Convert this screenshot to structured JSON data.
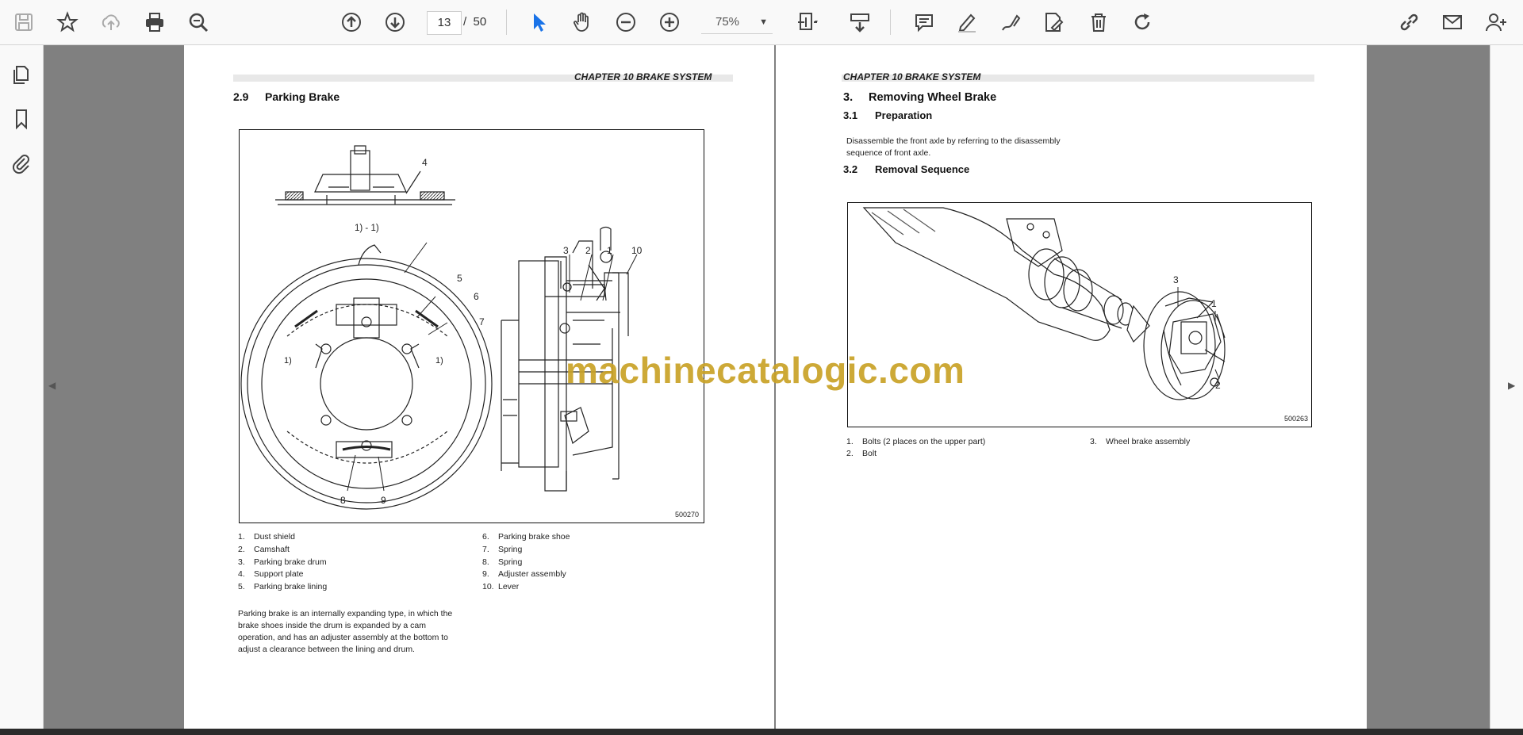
{
  "toolbar": {
    "current_page": "13",
    "page_separator": "/",
    "total_pages": "50",
    "zoom": "75%"
  },
  "left_page": {
    "header": "CHAPTER 10  BRAKE SYSTEM",
    "section_num": "2.9",
    "section_title": "Parking Brake",
    "figure_id": "500270",
    "callouts": {
      "top_caption": "1) - 1)",
      "c4": "4",
      "c5": "5",
      "c6": "6",
      "c7": "7",
      "c8": "8",
      "c9": "9",
      "cl1": "1)",
      "cr1": "1)",
      "s3": "3",
      "s2": "2",
      "s1": "1",
      "s10": "10"
    },
    "legend_left": [
      {
        "n": "1.",
        "t": "Dust shield"
      },
      {
        "n": "2.",
        "t": "Camshaft"
      },
      {
        "n": "3.",
        "t": "Parking brake drum"
      },
      {
        "n": "4.",
        "t": "Support plate"
      },
      {
        "n": "5.",
        "t": "Parking brake lining"
      }
    ],
    "legend_right": [
      {
        "n": "6.",
        "t": "Parking brake shoe"
      },
      {
        "n": "7.",
        "t": "Spring"
      },
      {
        "n": "8.",
        "t": "Spring"
      },
      {
        "n": "9.",
        "t": "Adjuster assembly"
      },
      {
        "n": "10.",
        "t": "Lever"
      }
    ],
    "paragraph_lines": [
      "Parking brake is an internally expanding type, in which the",
      "brake  shoes  inside  the  drum  is  expanded  by  a  cam",
      "operation, and has an adjuster assembly at the bottom to",
      "adjust a clearance between the lining and drum."
    ]
  },
  "right_page": {
    "header": "CHAPTER 10  BRAKE SYSTEM",
    "section_num": "3.",
    "section_title": "Removing Wheel Brake",
    "sub1_num": "3.1",
    "sub1_title": "Preparation",
    "prep_lines": [
      "Disassemble the front axle by referring to the disassembly",
      "sequence of front axle."
    ],
    "sub2_num": "3.2",
    "sub2_title": "Removal Sequence",
    "figure_id": "500263",
    "callouts": {
      "c3": "3",
      "c1": "1",
      "c2": "2"
    },
    "legend": [
      {
        "n": "1.",
        "t": "Bolts (2 places on the upper part)"
      },
      {
        "n": "2.",
        "t": "Bolt"
      },
      {
        "n": "3.",
        "t": "Wheel brake assembly"
      }
    ]
  },
  "watermark": "machinecatalogic.com",
  "icons": {
    "save": "save-icon",
    "bookmark_star": "star-icon",
    "upload": "cloud-upload-icon",
    "print": "print-icon",
    "zoom_search": "zoom-search-icon",
    "prev_page": "arrow-up-circle-icon",
    "next_page": "arrow-down-circle-icon",
    "select": "cursor-icon",
    "hand": "hand-icon",
    "zoom_out": "minus-circle-icon",
    "zoom_in": "plus-circle-icon",
    "fit": "fit-page-icon",
    "scroll_mode": "scroll-mode-icon",
    "comment": "comment-icon",
    "highlight": "pen-icon",
    "draw": "draw-icon",
    "edit_text": "edit-icon",
    "delete": "trash-icon",
    "rotate": "rotate-icon",
    "share_link": "link-icon",
    "email": "mail-icon",
    "add_user": "add-user-icon",
    "pages_panel": "pages-icon",
    "bookmarks_panel": "bookmark-icon",
    "attachments_panel": "paperclip-icon"
  }
}
